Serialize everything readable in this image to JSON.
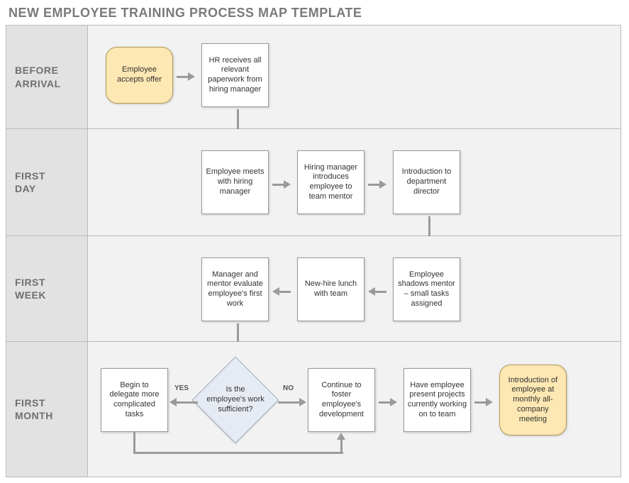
{
  "title": "NEW EMPLOYEE TRAINING PROCESS MAP TEMPLATE",
  "lanes": {
    "before_arrival": "BEFORE\nARRIVAL",
    "first_day": "FIRST\nDAY",
    "first_week": "FIRST\nWEEK",
    "first_month": "FIRST\nMONTH"
  },
  "nodes": {
    "n1": "Employee accepts offer",
    "n2": "HR receives all relevant paperwork from hiring manager",
    "n3": "Employee meets with hiring manager",
    "n4": "Hiring manager introduces employee to team mentor",
    "n5": "Introduction to department director",
    "n6": "Employee shadows mentor – small tasks assigned",
    "n7": "New-hire lunch with team",
    "n8": "Manager and mentor evaluate employee's first work",
    "d1": "Is the employee's work sufficient?",
    "n9": "Begin to delegate more complicated tasks",
    "n10": "Continue to foster employee's development",
    "n11": "Have employee present projects currently working on to team",
    "n12": "Introduction of employee at monthly all-company meeting"
  },
  "edge_labels": {
    "yes": "YES",
    "no": "NO"
  }
}
